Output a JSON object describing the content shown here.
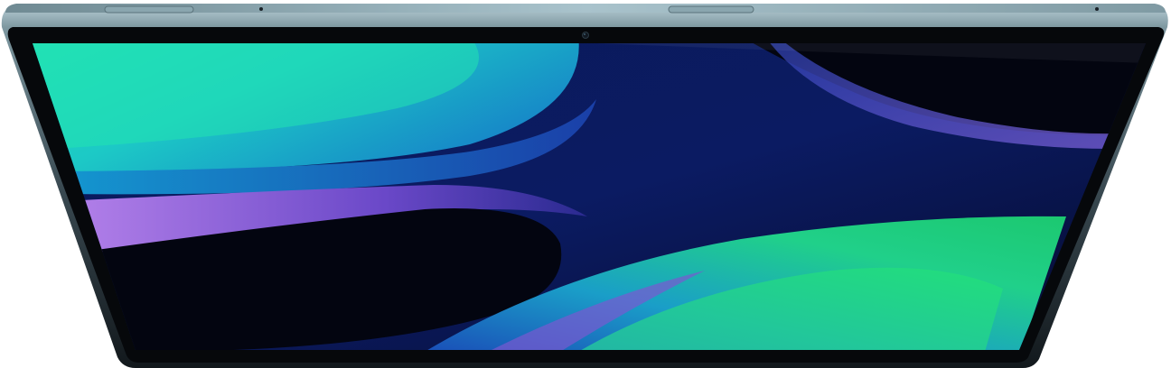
{
  "scene": {
    "subject": "tablet-top-view",
    "colors": {
      "background": "#ffffff",
      "frame_light": "#a9c3cc",
      "frame_mid": "#6f8891",
      "frame_dark": "#1a2228",
      "bezel": "#06080b",
      "screen_deep": "#050a2a",
      "screen_navy": "#0b1b62",
      "swirl_teal": "#1fd6c0",
      "swirl_green": "#1ed27a",
      "swirl_cyan": "#18a8d8",
      "swirl_blue": "#2a4fd6",
      "swirl_purple": "#9a6ae0"
    },
    "icons": [
      "camera-icon",
      "volume-button-icon",
      "power-button-icon",
      "microphone-icon"
    ]
  }
}
